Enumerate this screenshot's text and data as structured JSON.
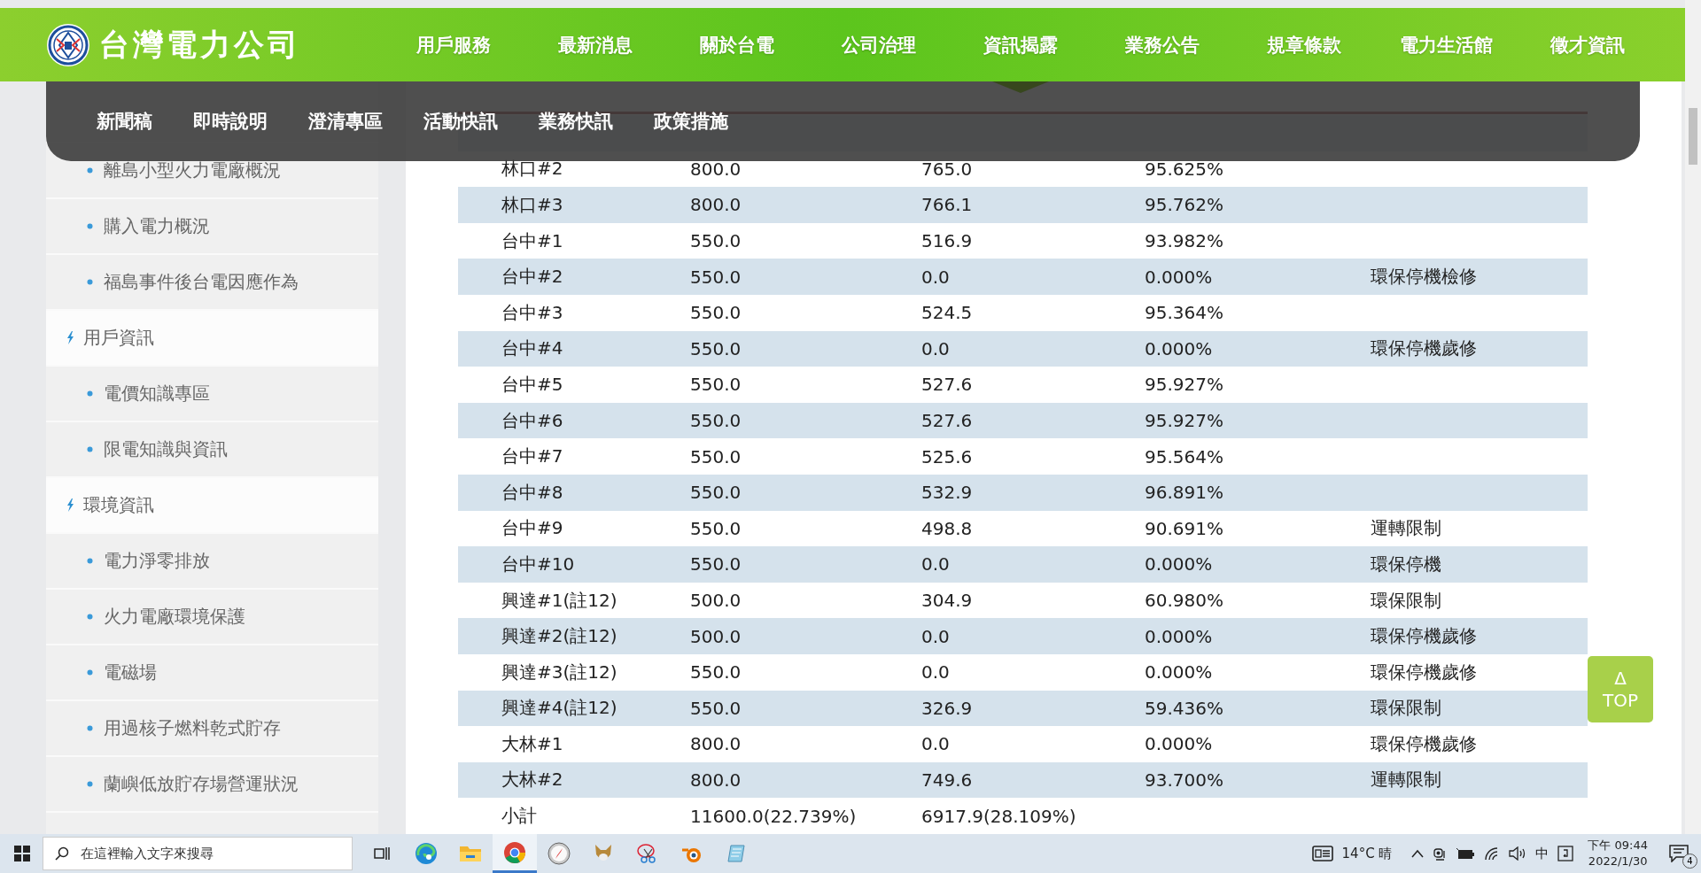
{
  "header": {
    "logo_text": "台灣電力公司",
    "nav": [
      {
        "label": "用戶服務",
        "expanded": false
      },
      {
        "label": "最新消息",
        "expanded": false
      },
      {
        "label": "關於台電",
        "expanded": false
      },
      {
        "label": "公司治理",
        "expanded": false
      },
      {
        "label": "資訊揭露",
        "expanded": true
      },
      {
        "label": "業務公告",
        "expanded": false
      },
      {
        "label": "規章條款",
        "expanded": false
      },
      {
        "label": "電力生活館",
        "expanded": false
      },
      {
        "label": "徵才資訊",
        "expanded": false
      }
    ]
  },
  "dropdown": {
    "items": [
      "新聞稿",
      "即時說明",
      "澄清專區",
      "活動快訊",
      "業務快訊",
      "政策措施"
    ]
  },
  "sidebar": {
    "items": [
      {
        "kind": "link",
        "label": "離島小型火力電廠概況"
      },
      {
        "kind": "link",
        "label": "購入電力概況"
      },
      {
        "kind": "link",
        "label": "福島事件後台電因應作為"
      },
      {
        "kind": "section",
        "label": "用戶資訊"
      },
      {
        "kind": "link",
        "label": "電價知識專區"
      },
      {
        "kind": "link",
        "label": "限電知識與資訊"
      },
      {
        "kind": "section",
        "label": "環境資訊"
      },
      {
        "kind": "link",
        "label": "電力淨零排放"
      },
      {
        "kind": "link",
        "label": "火力電廠環境保護"
      },
      {
        "kind": "link",
        "label": "電磁場"
      },
      {
        "kind": "link",
        "label": "用過核子燃料乾式貯存"
      },
      {
        "kind": "link",
        "label": "蘭嶼低放貯存場營運狀況"
      }
    ]
  },
  "table": {
    "rows": [
      [
        "林口#2",
        "800.0",
        "765.0",
        "95.625%",
        ""
      ],
      [
        "林口#3",
        "800.0",
        "766.1",
        "95.762%",
        ""
      ],
      [
        "台中#1",
        "550.0",
        "516.9",
        "93.982%",
        ""
      ],
      [
        "台中#2",
        "550.0",
        "0.0",
        "0.000%",
        "環保停機檢修"
      ],
      [
        "台中#3",
        "550.0",
        "524.5",
        "95.364%",
        ""
      ],
      [
        "台中#4",
        "550.0",
        "0.0",
        "0.000%",
        "環保停機歲修"
      ],
      [
        "台中#5",
        "550.0",
        "527.6",
        "95.927%",
        ""
      ],
      [
        "台中#6",
        "550.0",
        "527.6",
        "95.927%",
        ""
      ],
      [
        "台中#7",
        "550.0",
        "525.6",
        "95.564%",
        ""
      ],
      [
        "台中#8",
        "550.0",
        "532.9",
        "96.891%",
        ""
      ],
      [
        "台中#9",
        "550.0",
        "498.8",
        "90.691%",
        "運轉限制"
      ],
      [
        "台中#10",
        "550.0",
        "0.0",
        "0.000%",
        "環保停機"
      ],
      [
        "興達#1(註12)",
        "500.0",
        "304.9",
        "60.980%",
        "環保限制"
      ],
      [
        "興達#2(註12)",
        "500.0",
        "0.0",
        "0.000%",
        "環保停機歲修"
      ],
      [
        "興達#3(註12)",
        "550.0",
        "0.0",
        "0.000%",
        "環保停機歲修"
      ],
      [
        "興達#4(註12)",
        "550.0",
        "326.9",
        "59.436%",
        "環保限制"
      ],
      [
        "大林#1",
        "800.0",
        "0.0",
        "0.000%",
        "環保停機歲修"
      ],
      [
        "大林#2",
        "800.0",
        "749.6",
        "93.700%",
        "運轉限制"
      ]
    ],
    "subtotal": [
      "小計",
      "11600.0(22.739%)",
      "6917.9(28.109%)"
    ]
  },
  "top_button": {
    "icon": "Δ",
    "label": "TOP"
  },
  "taskbar": {
    "search_placeholder": "在這裡輸入文字來搜尋",
    "apps": [
      {
        "kind": "taskview",
        "selected": false
      },
      {
        "kind": "edge",
        "selected": false
      },
      {
        "kind": "explorer",
        "selected": false
      },
      {
        "kind": "chrome",
        "selected": true
      },
      {
        "kind": "compass",
        "selected": false
      },
      {
        "kind": "fox",
        "selected": false
      },
      {
        "kind": "scissors",
        "selected": false
      },
      {
        "kind": "blender",
        "selected": false
      },
      {
        "kind": "notepad",
        "selected": false
      }
    ],
    "weather": "14°C 晴",
    "ime": "中",
    "time": "下午 09:44",
    "date": "2022/1/30",
    "notifications": "4"
  }
}
